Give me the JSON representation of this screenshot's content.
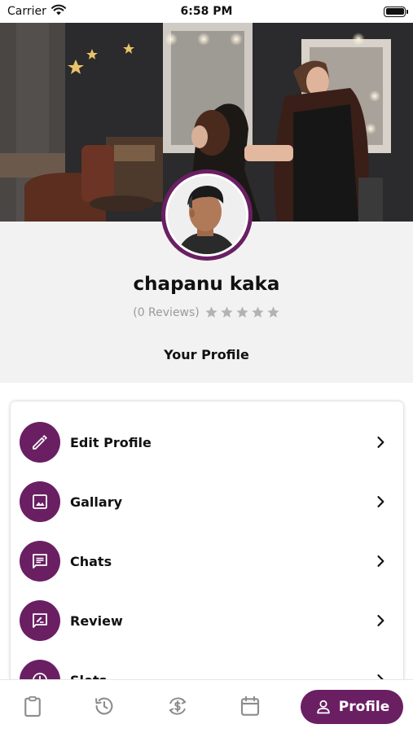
{
  "status_bar": {
    "carrier": "Carrier",
    "time": "6:58 PM",
    "icons": [
      "wifi-icon",
      "battery-icon"
    ]
  },
  "profile": {
    "name": "chapanu kaka",
    "reviews_text": "(0 Reviews)",
    "rating": 0,
    "max_rating": 5,
    "section_title": "Your Profile"
  },
  "menu": {
    "items": [
      {
        "label": "Edit Profile",
        "icon": "pencil-icon"
      },
      {
        "label": "Gallary",
        "icon": "image-icon"
      },
      {
        "label": "Chats",
        "icon": "chat-icon"
      },
      {
        "label": "Review",
        "icon": "review-icon"
      },
      {
        "label": "Slots",
        "icon": "clock-icon"
      }
    ]
  },
  "tab_bar": {
    "tabs": [
      {
        "icon": "clipboard-icon"
      },
      {
        "icon": "history-icon"
      },
      {
        "icon": "dollar-sync-icon"
      },
      {
        "icon": "calendar-icon"
      }
    ],
    "active": {
      "label": "Profile",
      "icon": "user-icon"
    }
  },
  "colors": {
    "accent": "#6a1f63",
    "background": "#f2f2f2",
    "star_empty": "#b3b3b3",
    "tab_icon": "#8c8c8c"
  }
}
